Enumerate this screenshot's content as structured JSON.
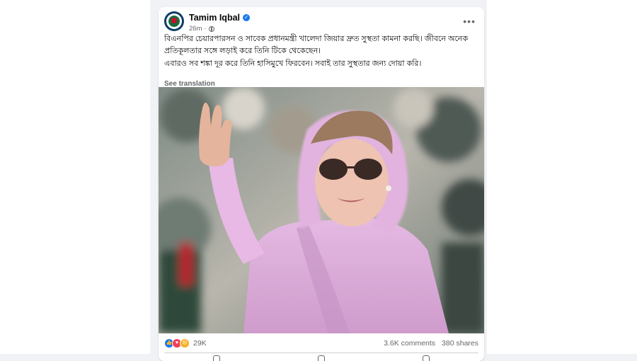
{
  "post": {
    "author": "Tamim Iqbal",
    "time": "26m",
    "text_lines": [
      "বিএনপির চেয়ারপারসন ও সাবেক প্রধানমন্ত্রী খালেদা জিয়ার দ্রুত সুস্থতা কামনা করছি। জীবনে অনেক প্রতিকূলতার সঙ্গে লড়াই করে তিনি টিকে থেকেছেন।",
      "এবারও সব শঙ্কা দূর করে তিনি হাসিমুখে ফিরবেন। সবাই তার সুস্থতার জন্য দোয়া করি।"
    ],
    "see_translation": "See translation",
    "reaction_count": "29K",
    "comments": "3.6K comments",
    "shares": "380 shares",
    "colors": {
      "verified": "#1877f2",
      "saree": "#d9a9d8"
    },
    "icons": [
      "verified-icon",
      "globe-icon",
      "more-icon",
      "like-reaction-icon",
      "love-reaction-icon",
      "sad-reaction-icon"
    ]
  }
}
